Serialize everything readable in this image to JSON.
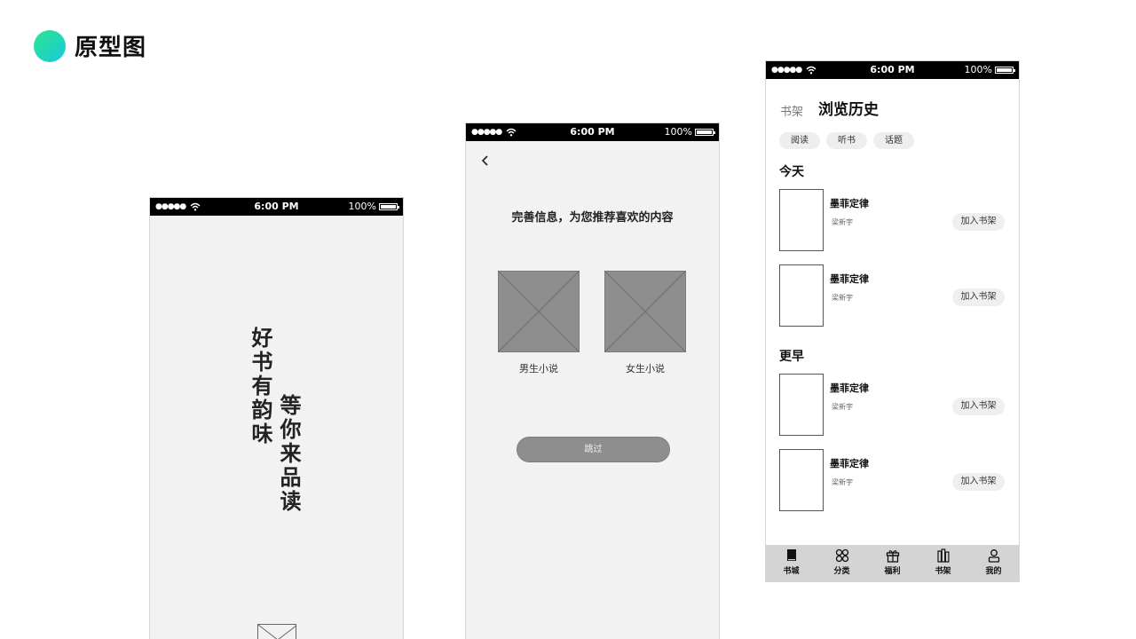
{
  "slide": {
    "title": "原型图"
  },
  "status_bar": {
    "signal": "●●●●●",
    "time": "6:00 PM",
    "battery": "100%"
  },
  "screen_splash": {
    "slogan_line1": "好书有韵味",
    "slogan_line2": "等你来品读"
  },
  "screen_preference": {
    "prompt": "完善信息，为您推荐喜欢的内容",
    "options": [
      {
        "label": "男生小说"
      },
      {
        "label": "女生小说"
      }
    ],
    "skip_label": "跳过"
  },
  "screen_history": {
    "tab_shelf": "书架",
    "tab_history": "浏览历史",
    "chips": [
      {
        "label": "阅读"
      },
      {
        "label": "听书"
      },
      {
        "label": "话题"
      }
    ],
    "sections": [
      {
        "heading": "今天",
        "books": [
          {
            "title": "墨菲定律",
            "author": "梁新宇",
            "action": "加入书架"
          },
          {
            "title": "墨菲定律",
            "author": "梁新宇",
            "action": "加入书架"
          }
        ]
      },
      {
        "heading": "更早",
        "books": [
          {
            "title": "墨菲定律",
            "author": "梁新宇",
            "action": "加入书架"
          },
          {
            "title": "墨菲定律",
            "author": "梁新宇",
            "action": "加入书架"
          }
        ]
      }
    ],
    "tabbar": [
      {
        "label": "书城",
        "icon": "book-icon"
      },
      {
        "label": "分类",
        "icon": "category-icon"
      },
      {
        "label": "福利",
        "icon": "gift-icon"
      },
      {
        "label": "书架",
        "icon": "bookshelf-icon"
      },
      {
        "label": "我的",
        "icon": "user-icon"
      }
    ]
  },
  "colors": {
    "accent_gradient_start": "#2fe58a",
    "accent_gradient_end": "#18c9e0",
    "placeholder_gray": "#8e8e8e",
    "screen_bg": "#f2f2f2",
    "tabbar_bg": "#d4d4d4"
  }
}
